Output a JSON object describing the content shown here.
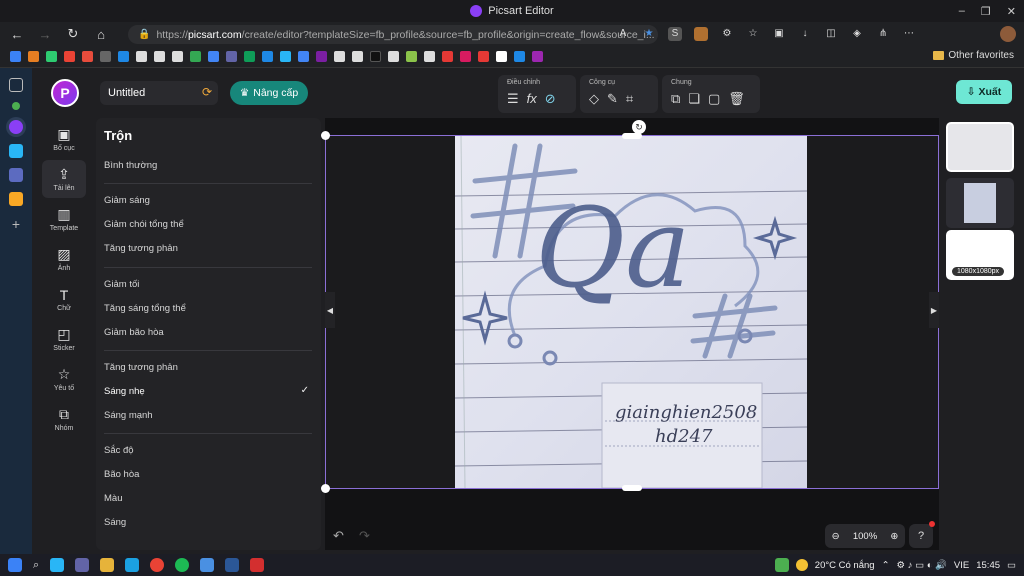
{
  "window": {
    "title": "Picsart Editor"
  },
  "browser": {
    "url_prefix": "https://",
    "url_host": "picsart.com",
    "url_path": "/create/editor?templateSize=fb_profile&source=fb_profile&origin=create_flow&source_i...",
    "other_favorites": "Other favorites"
  },
  "app": {
    "doc_name": "Untitled",
    "upgrade_label": "Nâng cấp",
    "export_label": "Xuất",
    "toolgroups": [
      {
        "label": "Điều chỉnh"
      },
      {
        "label": "Công cụ"
      },
      {
        "label": "Chung"
      }
    ],
    "adjust_fx": "fx",
    "rail": [
      {
        "label": "Bố cục",
        "icon": "layout-icon"
      },
      {
        "label": "Tải lên",
        "icon": "upload-icon"
      },
      {
        "label": "Template",
        "icon": "template-icon"
      },
      {
        "label": "Ảnh",
        "icon": "image-icon"
      },
      {
        "label": "Chữ",
        "icon": "text-icon"
      },
      {
        "label": "Sticker",
        "icon": "sticker-icon"
      },
      {
        "label": "Yêu tố",
        "icon": "star-icon"
      },
      {
        "label": "Nhóm",
        "icon": "group-icon"
      }
    ],
    "panel": {
      "title": "Trộn",
      "groups": [
        [
          "Bình thường"
        ],
        [
          "Giảm sáng",
          "Giảm chói tổng thể",
          "Tăng tương phản"
        ],
        [
          "Giảm tối",
          "Tăng sáng tổng thể",
          "Giảm bão hòa"
        ],
        [
          "Tăng tương phản",
          "Sáng nhẹ",
          "Sáng mạnh"
        ],
        [
          "Sắc độ",
          "Bão hòa",
          "Màu",
          "Sáng"
        ]
      ],
      "selected": "Sáng nhẹ"
    },
    "zoom": "100%",
    "pages": [
      {
        "badge": ""
      },
      {
        "badge": ""
      },
      {
        "badge": "1080x1080px"
      }
    ],
    "photo": {
      "handwriting_1": "giainghien2508",
      "handwriting_2": "hd247",
      "lettering": "Qa"
    }
  },
  "taskbar": {
    "weather": "20°C  Có nắng",
    "lang": "VIE",
    "time": "15:45"
  }
}
